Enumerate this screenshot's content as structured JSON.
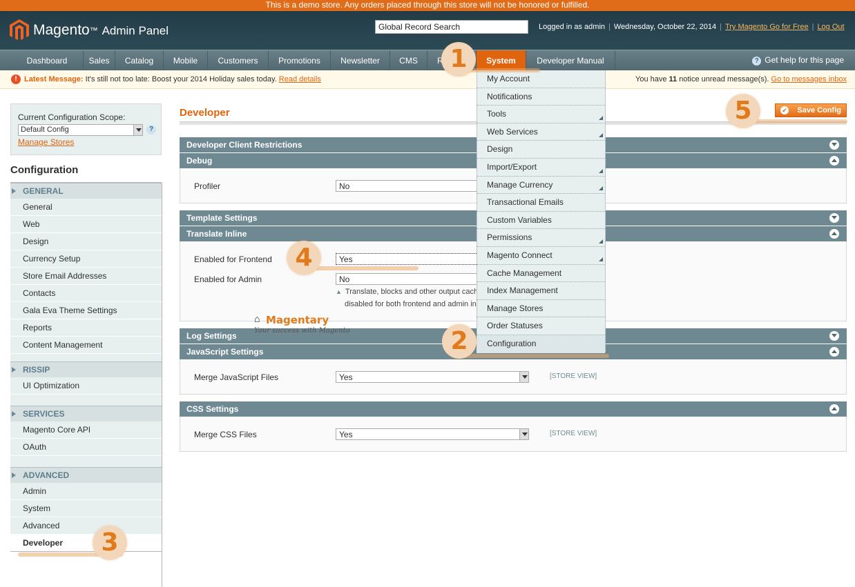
{
  "demo_notice": "This is a demo store. Any orders placed through this store will not be honored or fulfilled.",
  "header": {
    "logo": "Magento",
    "logo_sub": "Admin Panel",
    "search_value": "Global Record Search",
    "logged_in": "Logged in as admin",
    "date": "Wednesday, October 22, 2014",
    "try_link": "Try Magento Go for Free",
    "logout": "Log Out"
  },
  "nav": {
    "items": [
      "Dashboard",
      "Sales",
      "Catalog",
      "Mobile",
      "Customers",
      "Promotions",
      "Newsletter",
      "CMS",
      "R",
      "System",
      "Developer Manual"
    ],
    "help": "Get help for this page"
  },
  "message": {
    "label": "Latest Message:",
    "text": "It's still not too late: Boost your 2014 Holiday sales today.",
    "read_details": "Read details",
    "right_prefix": "You have",
    "count": "11",
    "right_suffix": "notice unread message(s).",
    "inbox_link": "Go to messages inbox"
  },
  "sidebar": {
    "scope_label": "Current Configuration Scope:",
    "scope_value": "Default Config",
    "manage_stores": "Manage Stores",
    "title": "Configuration",
    "groups": [
      {
        "name": "GENERAL",
        "items": [
          "General",
          "Web",
          "Design",
          "Currency Setup",
          "Store Email Addresses",
          "Contacts",
          "Gala Eva Theme Settings",
          "Reports",
          "Content Management"
        ]
      },
      {
        "name": "RISSIP",
        "items": [
          "UI Optimization"
        ]
      },
      {
        "name": "SERVICES",
        "items": [
          "Magento Core API",
          "OAuth"
        ]
      },
      {
        "name": "ADVANCED",
        "items": [
          "Admin",
          "System",
          "Advanced",
          "Developer"
        ]
      }
    ]
  },
  "main": {
    "title": "Developer",
    "save_button": "Save Config",
    "sections": {
      "client_restrictions": "Developer Client Restrictions",
      "debug": "Debug",
      "profiler_label": "Profiler",
      "profiler_value": "No",
      "template": "Template Settings",
      "translate": "Translate Inline",
      "frontend_label": "Enabled for Frontend",
      "frontend_value": "Yes",
      "admin_label": "Enabled for Admin",
      "admin_value": "No",
      "translate_note_1": "Translate, blocks and other output cach",
      "translate_note_2": "disabled for both frontend and admin inli",
      "log": "Log Settings",
      "js": "JavaScript Settings",
      "merge_js_label": "Merge JavaScript Files",
      "merge_js_value": "Yes",
      "css": "CSS Settings",
      "merge_css_label": "Merge CSS Files",
      "merge_css_value": "Yes",
      "store_view": "[STORE VIEW]"
    }
  },
  "system_menu": [
    "My Account",
    "Notifications",
    "Tools",
    "Web Services",
    "Design",
    "Import/Export",
    "Manage Currency",
    "Transactional Emails",
    "Custom Variables",
    "Permissions",
    "Magento Connect",
    "Cache Management",
    "Index Management",
    "Manage Stores",
    "Order Statuses",
    "Configuration"
  ],
  "callouts": [
    "1",
    "2",
    "3",
    "4",
    "5"
  ],
  "watermark": {
    "name": "Magentary",
    "tagline": "Your success with Magento"
  },
  "colors": {
    "accent": "#e0640e",
    "header": "#223c47",
    "nav": "#5e757d",
    "section": "#6f8992"
  }
}
